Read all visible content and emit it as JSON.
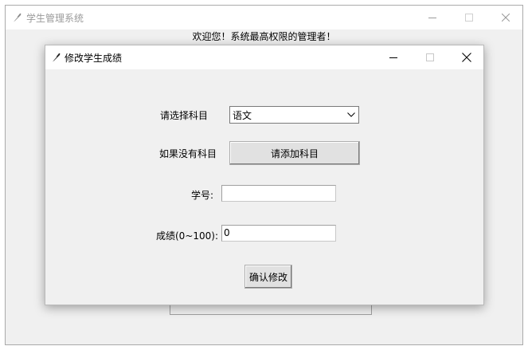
{
  "main_window": {
    "title": "学生管理系统",
    "welcome": "欢迎您！系统最高权限的管理者！"
  },
  "dialog": {
    "title": "修改学生成绩",
    "subject_label": "请选择科目",
    "subject_selected": "语文",
    "no_subject_label": "如果没有科目",
    "add_subject_button": "请添加科目",
    "student_id_label": "学号:",
    "student_id_value": "",
    "score_label": "成绩(0~100):",
    "score_value": "0",
    "confirm_button": "确认修改"
  },
  "icons": {
    "app": "feather-icon",
    "minimize": "minimize-icon",
    "maximize": "maximize-icon",
    "close": "close-icon",
    "dropdown": "chevron-down-icon"
  }
}
